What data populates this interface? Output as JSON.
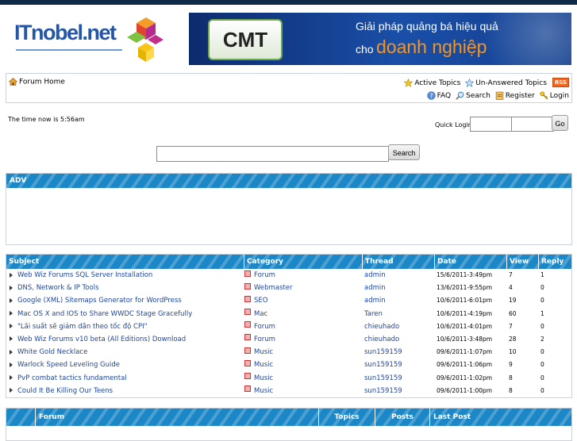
{
  "header": {
    "logo_text": "ITnobel.net",
    "banner": {
      "brand": "CMT",
      "line1": "Giải pháp quảng bá hiệu quả",
      "line2_prefix": "cho",
      "line2_highlight": "doanh nghiệp"
    }
  },
  "nav": {
    "home": "Forum Home",
    "active_topics": "Active Topics",
    "unanswered_topics": "Un-Answered Topics",
    "rss": "RSS",
    "faq": "FAQ",
    "search": "Search",
    "register": "Register",
    "login": "Login"
  },
  "status": {
    "time_now": "The time now is 5:56am"
  },
  "quick_login": {
    "label": "Quick Login",
    "username_value": "",
    "password_value": "",
    "go_label": "Go"
  },
  "search": {
    "input_value": "",
    "button_label": "Search"
  },
  "adv": {
    "title": "ADV"
  },
  "topics_table": {
    "headers": [
      "Subject",
      "Category",
      "Thread",
      "Date",
      "View",
      "Reply"
    ],
    "rows": [
      {
        "subject": "Web Wiz Forums SQL Server Installation",
        "category": "Forum",
        "thread": "admin",
        "date": "15/6/2011-3:49pm",
        "view": "7",
        "reply": "1"
      },
      {
        "subject": "DNS, Network & IP Tools",
        "category": "Webmaster",
        "thread": "admin",
        "date": "13/6/2011-9:55pm",
        "view": "4",
        "reply": "0"
      },
      {
        "subject": "Google (XML) Sitemaps Generator for WordPress",
        "category": "SEO",
        "thread": "admin",
        "date": "10/6/2011-6:01pm",
        "view": "19",
        "reply": "0"
      },
      {
        "subject": "Mac OS X and IOS to Share WWDC Stage Gracefully",
        "category": "Mac",
        "thread": "Taren",
        "date": "10/6/2011-4:19pm",
        "view": "60",
        "reply": "1"
      },
      {
        "subject": "\"Lãi suất sẽ giảm dần theo tốc độ CPI\"",
        "category": "Forum",
        "thread": "chieuhado",
        "date": "10/6/2011-4:01pm",
        "view": "7",
        "reply": "0"
      },
      {
        "subject": "Web Wiz Forums v10 beta (All Editions) Download",
        "category": "Forum",
        "thread": "chieuhado",
        "date": "10/6/2011-3:48pm",
        "view": "28",
        "reply": "2"
      },
      {
        "subject": "White Gold Necklace",
        "category": "Music",
        "thread": "sun159159",
        "date": "09/6/2011-1:07pm",
        "view": "10",
        "reply": "0"
      },
      {
        "subject": "Warlock Speed Leveling Guide",
        "category": "Music",
        "thread": "sun159159",
        "date": "09/6/2011-1:06pm",
        "view": "9",
        "reply": "0"
      },
      {
        "subject": "PvP combat tactics fundamental",
        "category": "Music",
        "thread": "sun159159",
        "date": "09/6/2011-1:02pm",
        "view": "8",
        "reply": "0"
      },
      {
        "subject": "Could It Be Killing Our Teens",
        "category": "Music",
        "thread": "sun159159",
        "date": "09/6/2011-1:00pm",
        "view": "8",
        "reply": "0"
      }
    ]
  },
  "forum_table": {
    "headers": [
      "Forum",
      "Topics",
      "Posts",
      "Last Post"
    ]
  },
  "colors": {
    "header_blue": "#1b87c6",
    "link_blue": "#2046a0",
    "banner_accent": "#f7941d"
  }
}
